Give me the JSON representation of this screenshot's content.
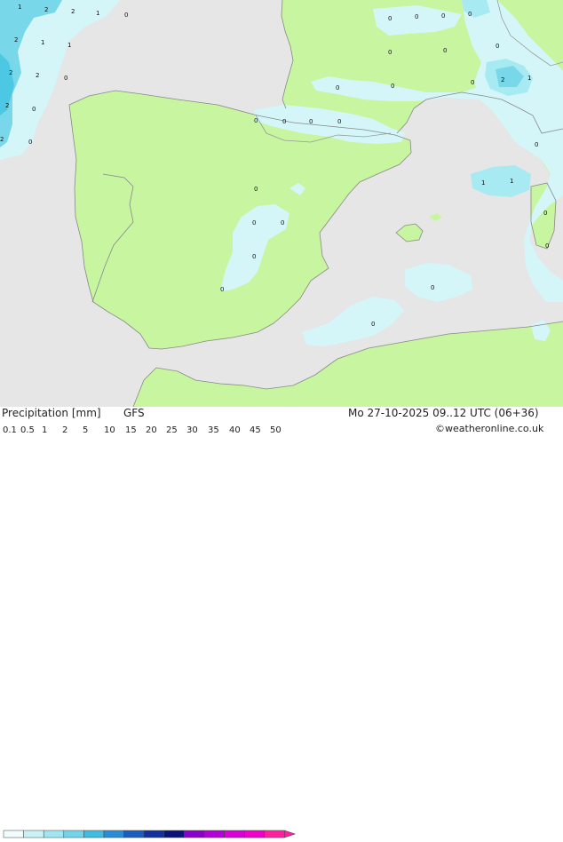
{
  "colors": {
    "sea": "#e6e6e6",
    "land": "#c8f5a0",
    "light_precip": "#d4f6f9",
    "light_precip_2": "#a8eaf2",
    "medium_precip": "#78d8ea",
    "strong_precip": "#4cc8e4"
  },
  "map": {
    "value_labels": [
      "1",
      "2",
      "2",
      "1",
      "0",
      "2",
      "1",
      "1",
      "2",
      "2",
      "0",
      "2",
      "0",
      "2",
      "0",
      "0",
      "0",
      "0",
      "0",
      "0",
      "0",
      "0",
      "0",
      "0",
      "2",
      "1",
      "0",
      "0",
      "0",
      "0",
      "0",
      "0",
      "0",
      "1",
      "1",
      "0",
      "0",
      "0",
      "0",
      "0",
      "0",
      "0",
      "0"
    ]
  },
  "footer": {
    "title": "Precipitation [mm]",
    "model": "GFS",
    "datetime": "Mo 27-10-2025 09..12 UTC (06+36)",
    "credit": "©weatheronline.co.uk",
    "legend_ticks": [
      "0.1",
      "0.5",
      "1",
      "2",
      "5",
      "10",
      "15",
      "20",
      "25",
      "30",
      "35",
      "40",
      "45",
      "50"
    ],
    "legend_colors": [
      "#f0fcfd",
      "#c8f2f6",
      "#a0e6f0",
      "#72d4ea",
      "#40bce0",
      "#2a8cd4",
      "#1c5cc0",
      "#1030a0",
      "#0a1478",
      "#8a00c8",
      "#b400d8",
      "#d800d8",
      "#f000c8",
      "#ff20a0"
    ]
  }
}
